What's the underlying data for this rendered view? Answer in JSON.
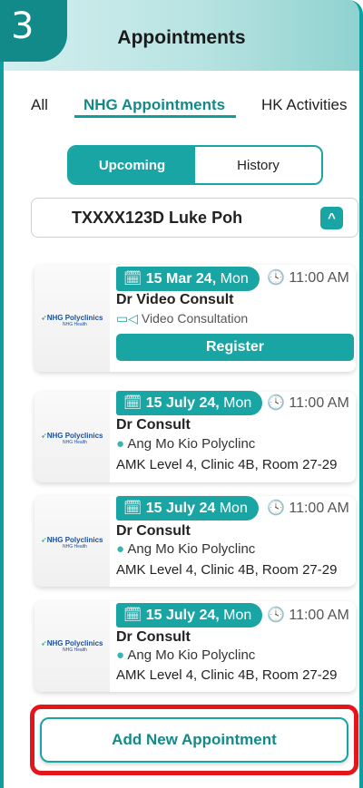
{
  "step_number": "3",
  "header": {
    "title": "Appointments",
    "back_icon": "arrow-left-icon"
  },
  "tabs": [
    {
      "label": "All",
      "active": false
    },
    {
      "label": "NHG Appointments",
      "active": true
    },
    {
      "label": "HK Activities",
      "active": false
    }
  ],
  "segmented": {
    "upcoming": "Upcoming",
    "history": "History",
    "selected": "Upcoming"
  },
  "patient": {
    "name": "TXXXX123D Luke Poh",
    "chevron_icon": "chevron-up-icon"
  },
  "logo": {
    "brand": "NHG Polyclinics",
    "sub": "NHG Health"
  },
  "appointments": [
    {
      "date_bold": "15 Mar 24,",
      "day": "Mon",
      "time": "11:00 AM",
      "doctor": "Dr Video Consult",
      "type": "Video Consultation",
      "action": "Register"
    },
    {
      "date_bold": "15 July 24,",
      "day": "Mon",
      "time": "11:00 AM",
      "doctor": "Dr Consult",
      "location": "Ang Mo Kio Polyclinc",
      "address": "AMK Level 4, Clinic 4B, Room 27-29"
    },
    {
      "date_bold": "15 July 24",
      "day": "Mon",
      "time": "11:00 AM",
      "doctor": "Dr Consult",
      "location": "Ang Mo Kio Polyclinc",
      "address": "AMK Level 4, Clinic 4B, Room 27-29"
    },
    {
      "date_bold": "15 July 24,",
      "day": "Mon",
      "time": "11:00 AM",
      "doctor": "Dr Consult",
      "location": "Ang Mo Kio Polyclinc",
      "address": "AMK Level 4, Clinic 4B, Room 27-29"
    }
  ],
  "add_button": "Add New Appointment",
  "colors": {
    "accent": "#18a5a4",
    "highlight": "#e5161b"
  }
}
